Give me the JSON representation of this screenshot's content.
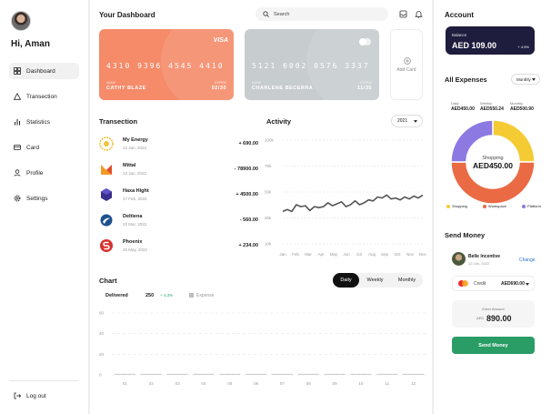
{
  "sidebar": {
    "greeting": "Hi, Aman",
    "items": [
      {
        "label": "Dashboard"
      },
      {
        "label": "Transection"
      },
      {
        "label": "Statistics"
      },
      {
        "label": "Card"
      },
      {
        "label": "Profile"
      },
      {
        "label": "Settings"
      }
    ],
    "logout": "Log out"
  },
  "header": {
    "title": "Your Dashboard",
    "search_placeholder": "Search"
  },
  "cards": [
    {
      "brand": "VISA",
      "number": "4310  9396  4545  4410",
      "name_label": "NAME",
      "name": "CATHY BLAZE",
      "expire_label": "EXPIRE",
      "expire": "02/30",
      "color": "#f58b69"
    },
    {
      "brand": "",
      "number": "5121  6002  0576  3337",
      "name_label": "NAME",
      "name": "CHARLENE BECERRA",
      "expire_label": "EXPIRE",
      "expire": "11/35",
      "color": "#c7ccce"
    }
  ],
  "add_card": "Add Card",
  "transactions": {
    "title": "Transection",
    "items": [
      {
        "name": "My Energy",
        "date": "12 Jan, 2022",
        "amount": "+ 690.00"
      },
      {
        "name": "Mittal",
        "date": "13 Jan, 2022",
        "amount": "- 78900.00"
      },
      {
        "name": "Haxa Hight",
        "date": "17 Feb, 2022",
        "amount": "+ 4500.00"
      },
      {
        "name": "Deltiena",
        "date": "22 Mar, 2022",
        "amount": "- 560.00"
      },
      {
        "name": "Phoenix",
        "date": "25 May, 2022",
        "amount": "+ 234.00"
      }
    ]
  },
  "activity": {
    "title": "Activity",
    "year": "2021"
  },
  "chart_data": [
    {
      "type": "line",
      "title": "Activity",
      "x": [
        "Jan",
        "Feb",
        "Mar",
        "Apr",
        "May",
        "Jun",
        "Jul",
        "Aug",
        "Sep",
        "Oct",
        "Nov",
        "Dec"
      ],
      "yticks": [
        "100k",
        "75k",
        "50k",
        "25k",
        "10k"
      ],
      "series": [
        {
          "values": [
            26,
            28,
            26,
            33,
            31,
            32,
            27,
            31,
            30,
            31,
            35,
            32,
            34,
            36,
            31,
            33,
            37,
            33,
            35,
            38,
            37,
            41,
            40,
            43,
            39,
            40,
            38,
            41,
            39,
            42,
            40,
            43
          ]
        }
      ],
      "color": "#555555"
    },
    {
      "type": "bar",
      "title": "Chart",
      "x": [
        "01",
        "02",
        "03",
        "04",
        "05",
        "06",
        "07",
        "08",
        "09",
        "10",
        "11",
        "12"
      ],
      "yticks": [
        "60",
        "40",
        "20",
        "0"
      ],
      "values": [
        0,
        0,
        0,
        0,
        0,
        0,
        0,
        0,
        0,
        0,
        0,
        0
      ],
      "ylim": [
        0,
        60
      ]
    },
    {
      "type": "pie",
      "title": "All Expenses",
      "center_label": "Shopping",
      "center_value": "AED450.00",
      "slices": [
        {
          "name": "Shopping",
          "value": 25,
          "color": "#f5cb33"
        },
        {
          "name": "Workspace",
          "value": 50,
          "color": "#ea6a43"
        },
        {
          "name": "Platform",
          "value": 25,
          "color": "#8c79e2"
        }
      ]
    }
  ],
  "chart": {
    "title": "Chart",
    "delivered_label": "Delivered",
    "delivered_value": "250",
    "delivered_change": "+ 4.3%",
    "expense_label": "Expense",
    "tabs": [
      "Daily",
      "Weekly",
      "Monthly"
    ]
  },
  "account": {
    "title": "Account",
    "balance_label": "Balance",
    "balance": "AED 109.00",
    "change": "+ 4.5%"
  },
  "expenses": {
    "title": "All Expenses",
    "period": "Monthly",
    "daily_label": "Daily",
    "daily_value": "AED450.00",
    "weekly_label": "Weekly",
    "weekly_value": "AED550.24",
    "monthly_label": "Monthly",
    "monthly_value": "AED500.90"
  },
  "send": {
    "title": "Send Money",
    "contact_name": "Belle Incentive",
    "contact_date": "12 Jan, 2022",
    "change": "Change",
    "credit_label": "Credit",
    "credit_value": "AED690.00",
    "enter_label": "Enter Amount",
    "currency": "AED",
    "amount": "890.00",
    "button": "Send Money"
  }
}
